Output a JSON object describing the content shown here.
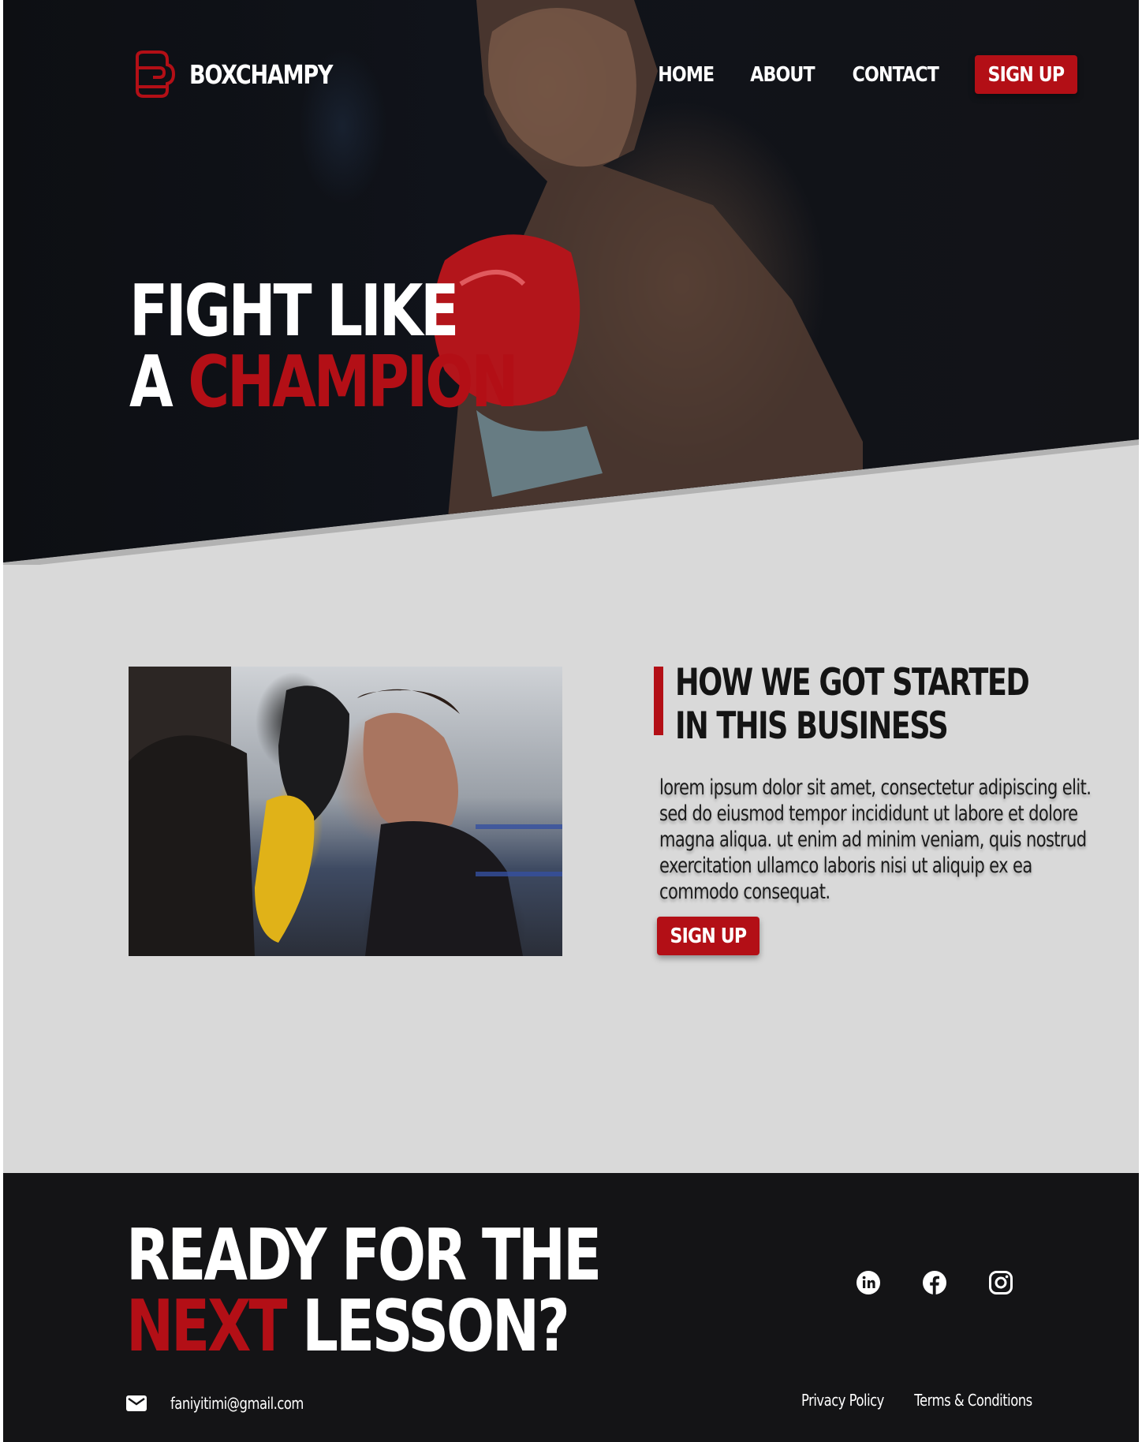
{
  "brand": {
    "name": "BOXCHAMPY",
    "logo_icon": "boxing-glove-icon"
  },
  "nav": {
    "items": [
      "HOME",
      "ABOUT",
      "CONTACT"
    ],
    "signup_label": "SIGN UP"
  },
  "hero": {
    "line1": "FIGHT LIKE",
    "line2_prefix": "A ",
    "line2_highlight": "CHAMPION"
  },
  "about": {
    "heading_line1": "HOW WE GOT STARTED",
    "heading_line2": "IN THIS BUSINESS",
    "body": "lorem ipsum dolor sit amet, consectetur adipiscing elit. sed do eiusmod tempor incididunt ut labore et dolore magna aliqua. ut enim ad minim veniam, quis nostrud exercitation ullamco laboris nisi ut aliquip ex ea commodo consequat.",
    "signup_label": "SIGN UP"
  },
  "footer": {
    "title_line1": "READY FOR THE",
    "title_line2_highlight": "NEXT",
    "title_line2_rest": " LESSON?",
    "email": "faniyitimi@gmail.com",
    "email_icon": "mail-icon",
    "social_icons": [
      "linkedin-icon",
      "facebook-icon",
      "instagram-icon"
    ],
    "links": [
      "Privacy Policy",
      "Terms & Conditions"
    ]
  },
  "colors": {
    "accent": "#b30f16",
    "dark": "#141416",
    "light_bg": "#d9d9d9",
    "text": "#ffffff"
  }
}
